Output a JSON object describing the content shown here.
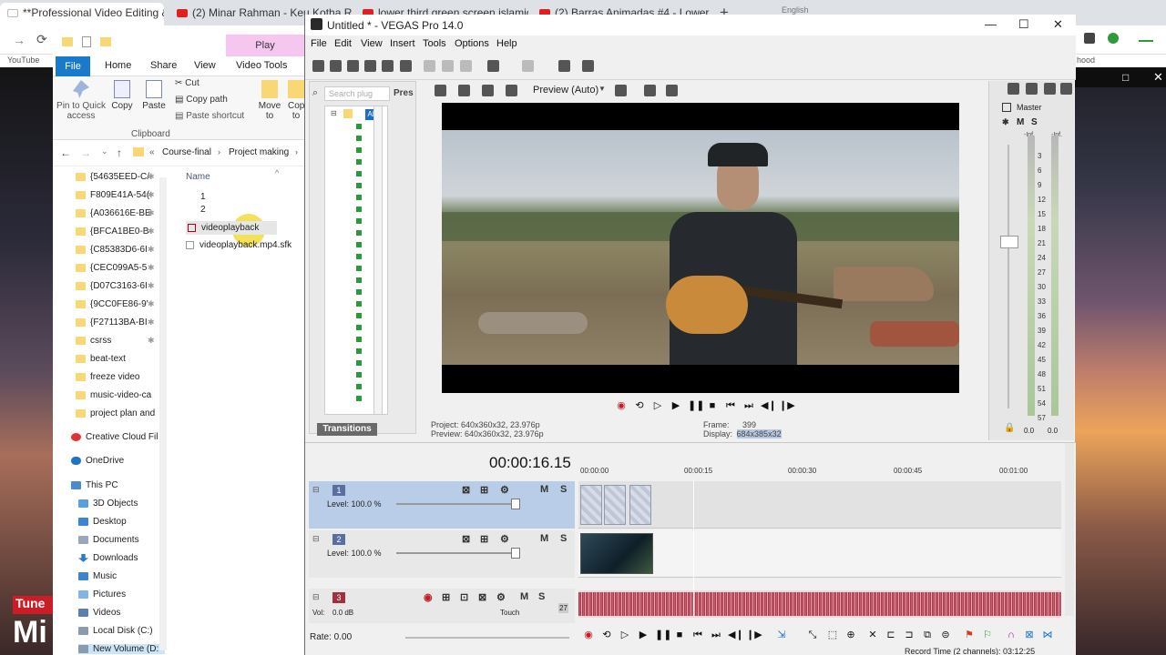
{
  "chrome": {
    "tabs": [
      {
        "label": "**Professional Video Editing & D",
        "active": true
      },
      {
        "label": "(2) Minar Rahman - Keu Kotha R",
        "active": false
      },
      {
        "label": "lower third green screen islamic",
        "active": false
      },
      {
        "label": "(2) Barras Animadas #4 - Lower",
        "active": false
      }
    ],
    "bookmark_left": "YouTube",
    "bookmark_right": "hood",
    "language": "English"
  },
  "explorer": {
    "play_tab": "Play",
    "tabs": [
      "File",
      "Home",
      "Share",
      "View",
      "Video Tools"
    ],
    "ribbon": {
      "pin": "Pin to Quick access",
      "copy": "Copy",
      "paste": "Paste",
      "cut": "Cut",
      "copy_path": "Copy path",
      "paste_shortcut": "Paste shortcut",
      "move_to": "Move to",
      "copy_to": "Cop to",
      "clipboard": "Clipboard"
    },
    "breadcrumb": [
      "Course-final",
      "Project making"
    ],
    "column_name": "Name",
    "nav_items": [
      "{54635EED-C/",
      "F809E41A-54(",
      "{A036616E-BE",
      "{BFCA1BE0-B",
      "{C85383D6-6I",
      "{CEC099A5-5",
      "{D07C3163-6I",
      "{9CC0FE86-9'",
      "{F27113BA-BI",
      "csrss",
      "beat-text",
      "freeze video",
      "music-video-ca",
      "project plan and",
      "Creative Cloud Fil",
      "OneDrive",
      "This PC",
      "3D Objects",
      "Desktop",
      "Documents",
      "Downloads",
      "Music",
      "Pictures",
      "Videos",
      "Local Disk (C:)",
      "New Volume (D:"
    ],
    "files": [
      "1",
      "2",
      "videoplayback",
      "videoplayback.mp4.sfk"
    ]
  },
  "vegas": {
    "title": "Untitled * - VEGAS Pro 14.0",
    "menu": [
      "File",
      "Edit",
      "View",
      "Insert",
      "Tools",
      "Options",
      "Help"
    ],
    "search_placeholder": "Search plug",
    "pres_label": "Pres",
    "all_label": "All",
    "transitions_tab": "Transitions",
    "preview_mode": "Preview (Auto)",
    "project_info": "Project:  640x360x32, 23.976p",
    "preview_info": "Preview:  640x360x32, 23.976p",
    "frame_label": "Frame:",
    "frame_value": "399",
    "display_label": "Display:",
    "display_value": "684x385x32",
    "master_label": "Master",
    "master_inf": [
      "-Inf.",
      "-Inf."
    ],
    "db_scale": [
      "3",
      "6",
      "9",
      "12",
      "15",
      "18",
      "21",
      "24",
      "27",
      "30",
      "33",
      "36",
      "39",
      "42",
      "45",
      "48",
      "51",
      "54",
      "57"
    ],
    "db_zero": [
      "0.0",
      "0.0"
    ],
    "timecode": "00:00:16.15",
    "ruler": [
      "00:00:00",
      "00:00:15",
      "00:00:30",
      "00:00:45",
      "00:01:00"
    ],
    "tracks": [
      {
        "num": "1",
        "level": "Level: 100.0 %"
      },
      {
        "num": "2",
        "level": "Level: 100.0 %"
      },
      {
        "num": "3",
        "vol": "Vol:",
        "vol_value": "0.0 dB",
        "touch": "Touch",
        "value": "27"
      }
    ],
    "rate": "Rate: 0.00",
    "record_time": "Record Time (2 channels): 03:12:25"
  }
}
